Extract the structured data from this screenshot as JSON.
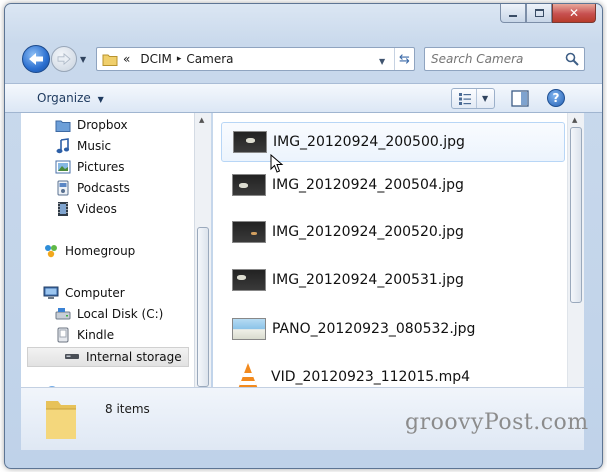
{
  "window": {
    "caption_buttons": [
      "minimize",
      "maximize",
      "close"
    ]
  },
  "address_bar": {
    "chevron": "«",
    "path": [
      "DCIM",
      "Camera"
    ]
  },
  "search": {
    "placeholder": "Search Camera"
  },
  "toolbar": {
    "organize_label": "Organize",
    "icons": [
      "view-list-icon",
      "preview-pane-icon",
      "help-icon"
    ]
  },
  "nav_pane": {
    "items": [
      {
        "label": "Dropbox",
        "icon": "dropbox-folder-icon"
      },
      {
        "label": "Music",
        "icon": "music-note-icon"
      },
      {
        "label": "Pictures",
        "icon": "pictures-icon"
      },
      {
        "label": "Podcasts",
        "icon": "podcasts-icon"
      },
      {
        "label": "Videos",
        "icon": "videos-icon"
      },
      {
        "label": "Homegroup",
        "icon": "homegroup-icon"
      },
      {
        "label": "Computer",
        "icon": "computer-icon"
      },
      {
        "label": "Local Disk (C:)",
        "icon": "local-disk-icon"
      },
      {
        "label": "Kindle",
        "icon": "kindle-device-icon"
      },
      {
        "label": "Internal storage",
        "icon": "internal-storage-icon",
        "selected": true
      }
    ]
  },
  "files": [
    {
      "name": "IMG_20120924_200500.jpg",
      "thumb": "night-photo"
    },
    {
      "name": "IMG_20120924_200504.jpg",
      "thumb": "night-photo"
    },
    {
      "name": "IMG_20120924_200520.jpg",
      "thumb": "night-photo"
    },
    {
      "name": "IMG_20120924_200531.jpg",
      "thumb": "night-photo"
    },
    {
      "name": "PANO_20120923_080532.jpg",
      "thumb": "panorama-photo"
    },
    {
      "name": "VID_20120923_112015.mp4",
      "thumb": "vlc-cone-icon"
    }
  ],
  "details": {
    "item_count": "8 items"
  },
  "watermark": "groovyPost.com",
  "colors": {
    "accent": "#2b6fd0",
    "hover_row": "#ecf4fd",
    "close_button": "#c75050"
  }
}
